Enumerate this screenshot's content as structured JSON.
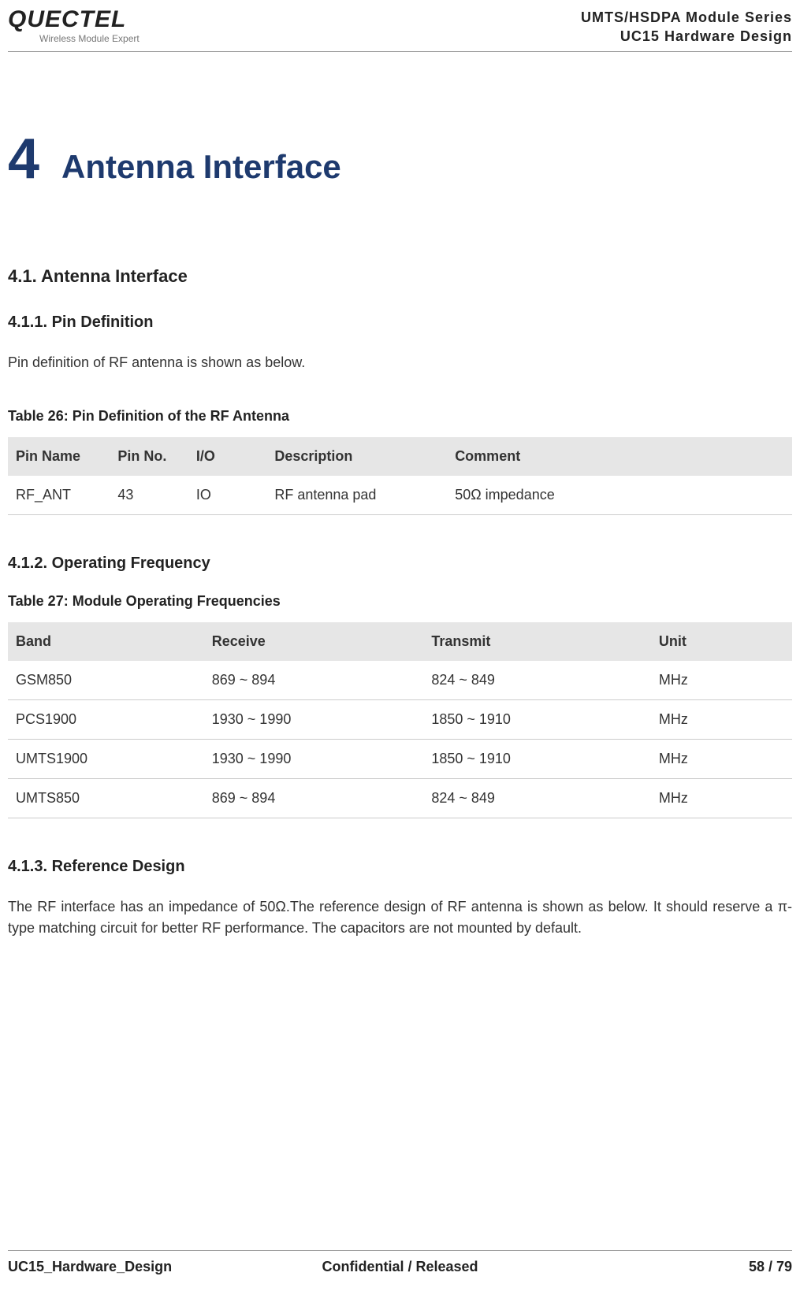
{
  "header": {
    "logo_main": "QUECTEL",
    "logo_sub": "Wireless Module Expert",
    "right_line1": "UMTS/HSDPA Module Series",
    "right_line2": "UC15 Hardware Design"
  },
  "chapter": {
    "num": "4",
    "title": "Antenna Interface"
  },
  "section_4_1": {
    "heading": "4.1. Antenna Interface"
  },
  "section_4_1_1": {
    "heading": "4.1.1.  Pin Definition",
    "intro": "Pin definition of RF antenna is shown as below."
  },
  "table26": {
    "caption": "Table 26: Pin Definition of the RF Antenna",
    "headers": {
      "c0": "Pin Name",
      "c1": "Pin No.",
      "c2": "I/O",
      "c3": "Description",
      "c4": "Comment"
    },
    "rows": [
      {
        "c0": "RF_ANT",
        "c1": "43",
        "c2": "IO",
        "c3": "RF antenna pad",
        "c4": "50Ω impedance"
      }
    ]
  },
  "section_4_1_2": {
    "heading": "4.1.2.  Operating Frequency"
  },
  "table27": {
    "caption": "Table 27: Module Operating Frequencies",
    "headers": {
      "c0": "Band",
      "c1": "Receive",
      "c2": "Transmit",
      "c3": "Unit"
    },
    "rows": [
      {
        "c0": "GSM850",
        "c1": "869 ~ 894",
        "c2": "824 ~ 849",
        "c3": "MHz"
      },
      {
        "c0": "PCS1900",
        "c1": "1930 ~ 1990",
        "c2": "1850 ~ 1910",
        "c3": "MHz"
      },
      {
        "c0": "UMTS1900",
        "c1": "1930 ~ 1990",
        "c2": "1850 ~ 1910",
        "c3": "MHz"
      },
      {
        "c0": "UMTS850",
        "c1": "869 ~ 894",
        "c2": "824 ~ 849",
        "c3": "MHz"
      }
    ]
  },
  "section_4_1_3": {
    "heading": "4.1.3.  Reference Design",
    "body": "The RF interface has an impedance of 50Ω.The reference design of RF antenna is shown as below. It should reserve a π-type matching circuit for better RF performance. The capacitors are not mounted by default."
  },
  "footer": {
    "left": "UC15_Hardware_Design",
    "center": "Confidential / Released",
    "right": "58 / 79"
  }
}
